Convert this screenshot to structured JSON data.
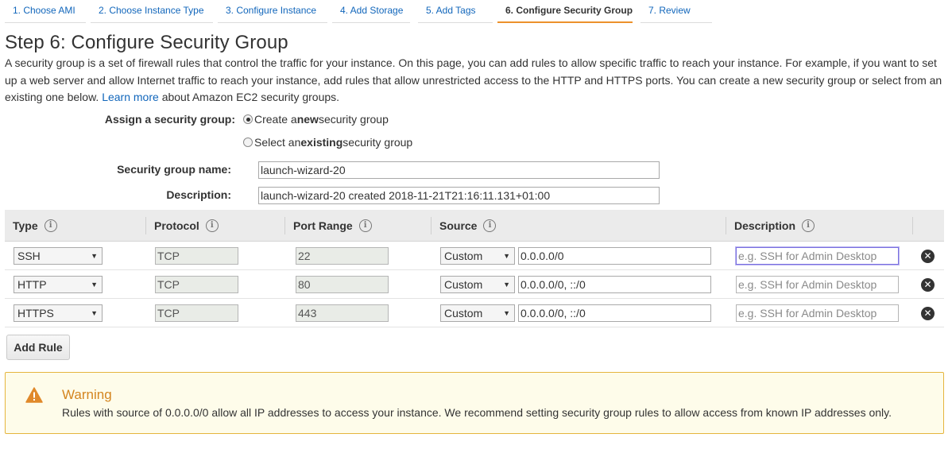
{
  "wizard": {
    "tabs": [
      {
        "label": "1. Choose AMI"
      },
      {
        "label": "2. Choose Instance Type"
      },
      {
        "label": "3. Configure Instance"
      },
      {
        "label": "4. Add Storage"
      },
      {
        "label": "5. Add Tags"
      },
      {
        "label": "6. Configure Security Group"
      },
      {
        "label": "7. Review"
      }
    ],
    "active_index": 5
  },
  "page": {
    "title": "Step 6: Configure Security Group",
    "intro_text": "A security group is a set of firewall rules that control the traffic for your instance. On this page, you can add rules to allow specific traffic to reach your instance. For example, if you want to set up a web server and allow Internet traffic to reach your instance, add rules that allow unrestricted access to the HTTP and HTTPS ports. You can create a new security group or select from an existing one below.",
    "learn_more": "Learn more",
    "intro_suffix": "about Amazon EC2 security groups."
  },
  "assign": {
    "label": "Assign a security group:",
    "option_new_pre": "Create a ",
    "option_new_bold": "new",
    "option_new_post": " security group",
    "option_existing_pre": "Select an ",
    "option_existing_bold": "existing",
    "option_existing_post": " security group",
    "selected": "new"
  },
  "group": {
    "name_label": "Security group name:",
    "name_value": "launch-wizard-20",
    "desc_label": "Description:",
    "desc_value": "launch-wizard-20 created 2018-11-21T21:16:11.131+01:00"
  },
  "table": {
    "headers": {
      "type": "Type",
      "protocol": "Protocol",
      "port_range": "Port Range",
      "source": "Source",
      "description": "Description"
    },
    "info_glyph": "i",
    "desc_placeholder": "e.g. SSH for Admin Desktop",
    "rows": [
      {
        "type": "SSH",
        "protocol": "TCP",
        "port": "22",
        "source_type": "Custom",
        "cidr": "0.0.0.0/0"
      },
      {
        "type": "HTTP",
        "protocol": "TCP",
        "port": "80",
        "source_type": "Custom",
        "cidr": "0.0.0.0/0, ::/0"
      },
      {
        "type": "HTTPS",
        "protocol": "TCP",
        "port": "443",
        "source_type": "Custom",
        "cidr": "0.0.0.0/0, ::/0"
      }
    ]
  },
  "add_rule_label": "Add Rule",
  "warning": {
    "title": "Warning",
    "body": "Rules with source of 0.0.0.0/0 allow all IP addresses to access your instance. We recommend setting security group rules to allow access from known IP addresses only."
  },
  "colors": {
    "link": "#1166bb",
    "active_tab_underline": "#ec912b",
    "warning_border": "#e5b53e",
    "warning_bg": "#fefcea",
    "warning_title": "#d4851f"
  },
  "icons": {
    "info": "info-icon",
    "remove": "remove-rule-icon",
    "warning": "warning-triangle-icon",
    "dropdown": "dropdown-arrow-icon"
  }
}
